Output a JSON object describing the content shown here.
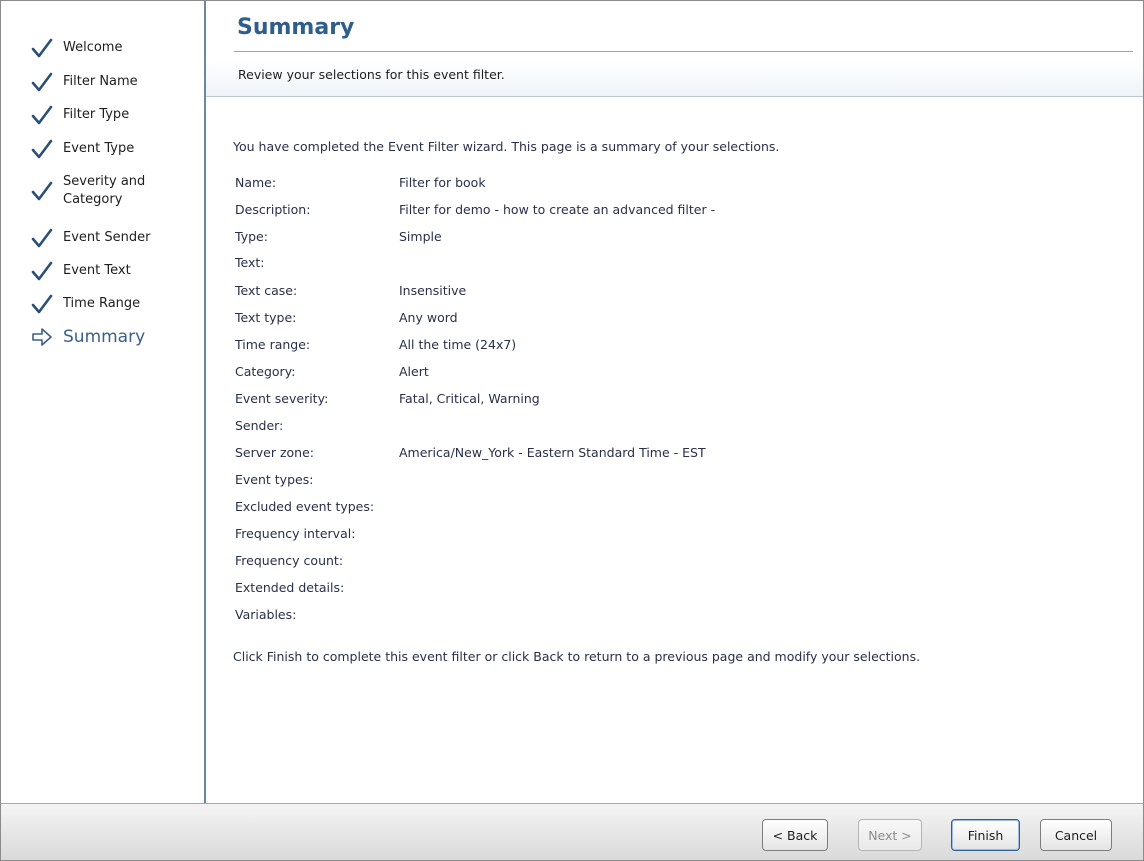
{
  "sidebar": {
    "steps": [
      {
        "label": "Welcome",
        "state": "done"
      },
      {
        "label": "Filter Name",
        "state": "done"
      },
      {
        "label": "Filter Type",
        "state": "done"
      },
      {
        "label": "Event Type",
        "state": "done"
      },
      {
        "label": "Severity and",
        "label2": "Category",
        "state": "done"
      },
      {
        "label": "Event Sender",
        "state": "done"
      },
      {
        "label": "Event Text",
        "state": "done"
      },
      {
        "label": "Time Range",
        "state": "done"
      },
      {
        "label": "Summary",
        "state": "current"
      }
    ]
  },
  "header": {
    "title": "Summary",
    "subtitle": "Review your selections for this event filter."
  },
  "main": {
    "intro": "You have completed the Event Filter wizard. This page is a summary of your selections.",
    "fields": [
      {
        "label": "Name:",
        "value": "Filter for book"
      },
      {
        "label": "Description:",
        "value": "Filter for demo - how to create an advanced filter -"
      },
      {
        "label": "Type:",
        "value": "Simple"
      },
      {
        "label": "Text:",
        "value": ""
      },
      {
        "label": "Text case:",
        "value": "Insensitive"
      },
      {
        "label": "Text type:",
        "value": "Any word"
      },
      {
        "label": "Time range:",
        "value": "All the time (24x7)"
      },
      {
        "label": "Category:",
        "value": "Alert"
      },
      {
        "label": "Event severity:",
        "value": "Fatal, Critical, Warning"
      },
      {
        "label": "Sender:",
        "value": ""
      },
      {
        "label": "Server zone:",
        "value": "America/New_York - Eastern Standard Time - EST"
      },
      {
        "label": "Event types:",
        "value": ""
      },
      {
        "label": "Excluded event types:",
        "value": ""
      },
      {
        "label": "Frequency interval:",
        "value": ""
      },
      {
        "label": "Frequency count:",
        "value": ""
      },
      {
        "label": "Extended details:",
        "value": ""
      },
      {
        "label": "Variables:",
        "value": ""
      }
    ],
    "outro": "Click Finish to complete this event filter or click Back to return to a previous page and modify your selections."
  },
  "footer": {
    "back_label": "< Back",
    "next_label": "Next >",
    "finish_label": "Finish",
    "cancel_label": "Cancel"
  },
  "colors": {
    "accent": "#2f5d8c",
    "check": "#2b5078",
    "sidebar_border": "#6b87a8"
  },
  "icons": {
    "done": "checkmark-icon",
    "current": "arrow-right-icon"
  }
}
